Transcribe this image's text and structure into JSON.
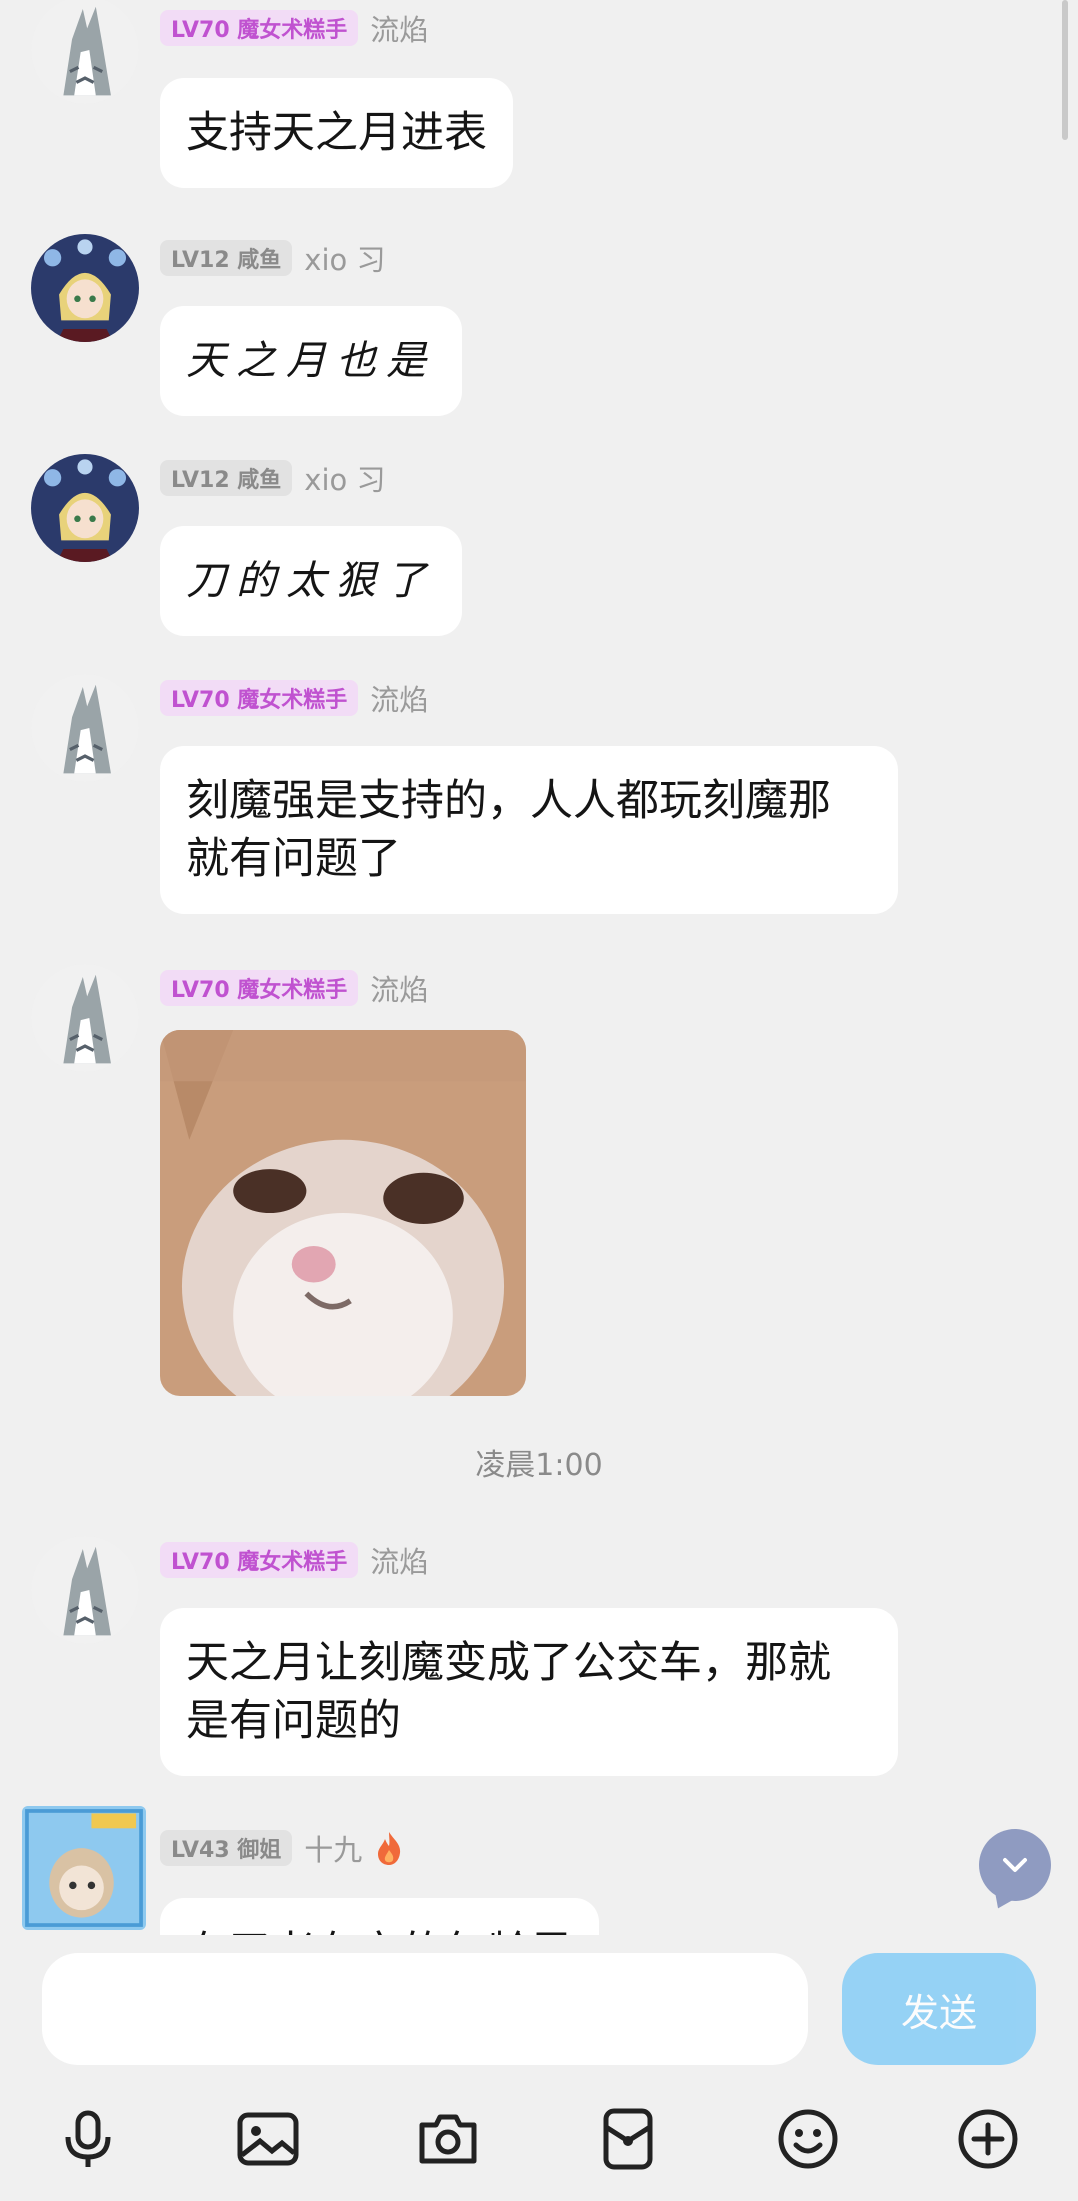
{
  "messages": [
    {
      "badge": "LV70 魔女术糕手",
      "name": "流焰",
      "text": "支持天之月进表"
    },
    {
      "badge": "LV12 咸鱼",
      "name": "xio 习",
      "text": "天之月也是"
    },
    {
      "badge": "LV12 咸鱼",
      "name": "xio 习",
      "text": "刀的太狠了"
    },
    {
      "badge": "LV70 魔女术糕手",
      "name": "流焰",
      "text_line1": "刻魔强是支持的，人人都玩刻魔那",
      "text_line2": "就有问题了"
    },
    {
      "badge": "LV70 魔女术糕手",
      "name": "流焰",
      "image": "cat-sticker"
    },
    {
      "badge": "LV70 魔女术糕手",
      "name": "流焰",
      "text_line1": "天之月让刻魔变成了公交车，那就",
      "text_line2": "是有问题的"
    },
    {
      "badge": "LV43 御姐",
      "name": "十九",
      "text": "有了老有它的年龄早"
    }
  ],
  "time_divider": "凌晨1:00",
  "input": {
    "placeholder": "",
    "send_label": "发送"
  },
  "toolbar": [
    "mic-icon",
    "image-icon",
    "camera-icon",
    "red-packet-icon",
    "emoji-icon",
    "plus-icon"
  ],
  "colors": {
    "background": "#f0f0f0",
    "badge_purple": "#c052d0",
    "send_button": "#86cdf6",
    "scroll_fab": "#8f9bc1"
  }
}
